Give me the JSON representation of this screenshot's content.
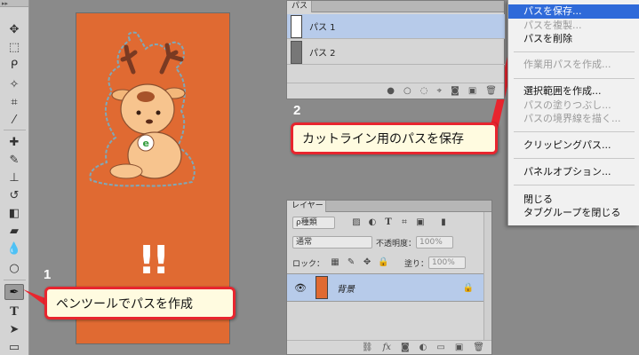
{
  "toolbar": {
    "grip_label": "▸▸",
    "tools": [
      "move-icon",
      "marquee-icon",
      "lasso-icon",
      "magic-wand-icon",
      "crop-icon",
      "eyedropper-icon",
      "healing-icon",
      "brush-icon",
      "stamp-icon",
      "history-brush-icon",
      "eraser-icon",
      "gradient-icon",
      "blur-icon",
      "dodge-icon",
      "pen-icon",
      "type-icon",
      "path-select-icon",
      "rectangle-icon"
    ]
  },
  "canvas": {
    "exclamation": "!!",
    "badge_letter": "e"
  },
  "callouts": {
    "step1_num": "1",
    "step1_text": "ペンツールでパスを作成",
    "step2_num": "2",
    "step2_text": "カットライン用のパスを保存"
  },
  "paths_panel": {
    "tab": "パス",
    "items": [
      {
        "label": "パス 1",
        "selected": true
      },
      {
        "label": "パス 2",
        "selected": false
      }
    ],
    "footer_icons": [
      "fill-path-icon",
      "stroke-path-icon",
      "load-selection-icon",
      "make-work-path-icon",
      "add-mask-icon",
      "new-path-icon",
      "delete-icon"
    ]
  },
  "menu": {
    "items": [
      {
        "label": "パスを保存...",
        "state": "highlighted"
      },
      {
        "label": "パスを複製...",
        "state": "disabled"
      },
      {
        "label": "パスを削除",
        "state": "enabled"
      },
      {
        "label": "作業用パスを作成...",
        "state": "disabled"
      },
      {
        "label": "選択範囲を作成...",
        "state": "enabled"
      },
      {
        "label": "パスの塗りつぶし...",
        "state": "disabled"
      },
      {
        "label": "パスの境界線を描く...",
        "state": "disabled"
      },
      {
        "label": "クリッピングパス...",
        "state": "enabled"
      },
      {
        "label": "パネルオプション...",
        "state": "enabled"
      },
      {
        "label": "閉じる",
        "state": "enabled"
      },
      {
        "label": "タブグループを閉じる",
        "state": "enabled"
      }
    ]
  },
  "layers_panel": {
    "tab": "レイヤー",
    "filter_label": "ρ種類",
    "blend_mode": "通常",
    "opacity_label": "不透明度：",
    "opacity_value": "100%",
    "lock_label": "ロック：",
    "fill_label": "塗り：",
    "fill_value": "100%",
    "layer_name": "背景"
  },
  "colors": {
    "accent_red": "#e8252e",
    "highlight_blue": "#2f6ad9",
    "canvas_orange": "#e06a32",
    "selection_blue": "#b7cbea"
  }
}
